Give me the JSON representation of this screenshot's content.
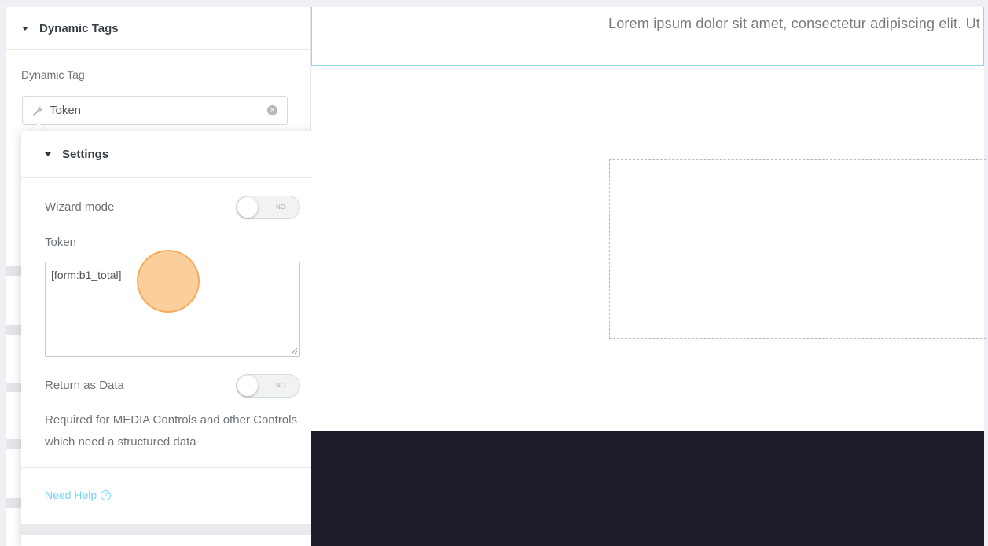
{
  "panel": {
    "section_title": "Dynamic Tags",
    "dynamic_tag_label": "Dynamic Tag",
    "selected_tag": "Token",
    "selected_tag_icon": "wrench-icon",
    "clear_icon": "close-circle-icon"
  },
  "settings": {
    "title": "Settings",
    "wizard_mode_label": "Wizard mode",
    "wizard_mode_state": "NO",
    "token_label": "Token",
    "token_value": "[form:b1_total]",
    "return_as_data_label": "Return as Data",
    "return_as_data_state": "NO",
    "note": "Required for MEDIA Controls and other Controls which need a structured data",
    "help_link": "Need Help",
    "help_icon": "question-circle-icon"
  },
  "preview": {
    "text": "Lorem ipsum dolor sit amet, consectetur adipiscing elit. Ut elit tellus, luctus nec ullamcorper mattis, pulvinar dapibus leo."
  },
  "colors": {
    "accent_link": "#71d7f7",
    "selection_border": "#8ddbe0",
    "dark_section": "#1c1c2a",
    "click_indicator": "#f8b160"
  }
}
